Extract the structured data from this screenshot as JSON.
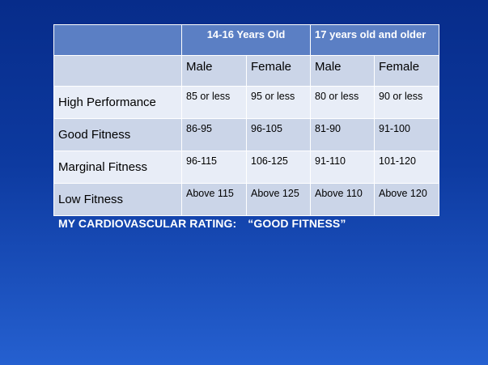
{
  "table": {
    "group_headers": [
      "",
      "14-16  Years Old",
      "17 years old and older"
    ],
    "sub_headers": [
      "",
      "Male",
      "Female",
      "Male",
      "Female"
    ],
    "rows": [
      {
        "label": "High Performance",
        "values": [
          "85 or less",
          "95 or less",
          "80 or less",
          "90 or less"
        ]
      },
      {
        "label": "Good Fitness",
        "values": [
          "86-95",
          "96-105",
          "81-90",
          "91-100"
        ]
      },
      {
        "label": "Marginal Fitness",
        "values": [
          "96-115",
          "106-125",
          "91-110",
          "101-120"
        ]
      },
      {
        "label": "Low Fitness",
        "values": [
          "Above 115",
          "Above 125",
          "Above 110",
          "Above 120"
        ]
      }
    ]
  },
  "rating": {
    "label": "MY CARDIOVASCULAR RATING:",
    "value": "“GOOD FITNESS”"
  }
}
